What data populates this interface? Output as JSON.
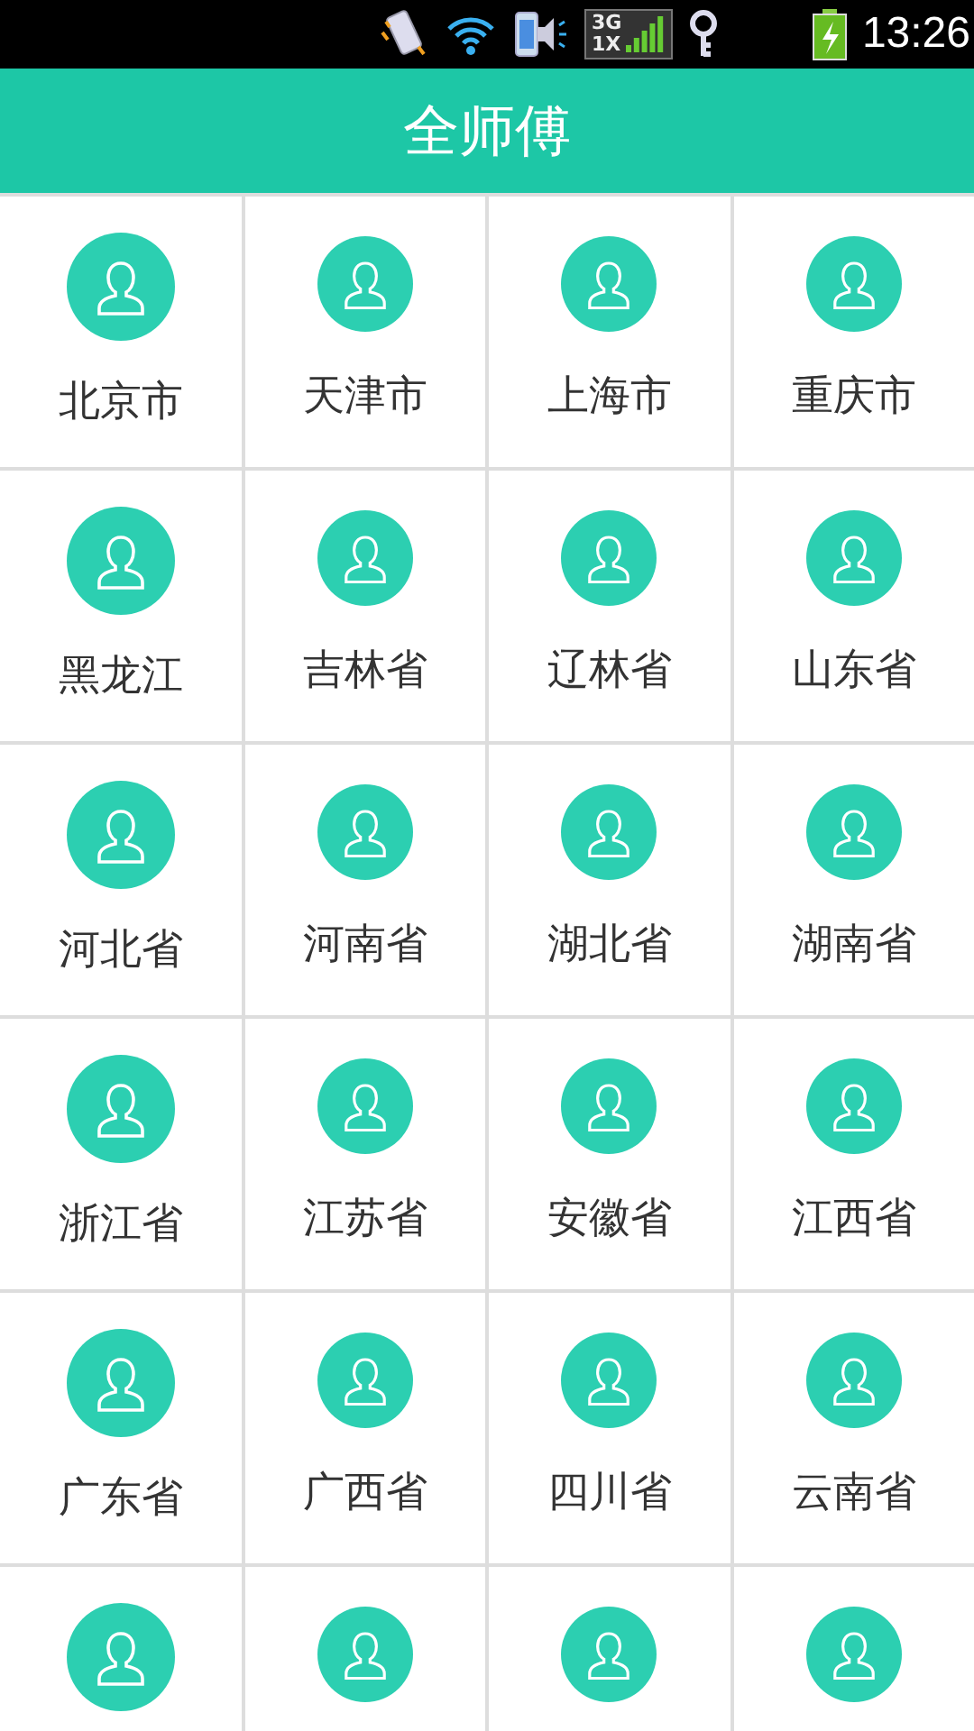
{
  "status_bar": {
    "network": [
      "3G",
      "1X"
    ],
    "time": "13:26"
  },
  "header": {
    "title": "全师傅"
  },
  "grid": [
    {
      "label": "北京市"
    },
    {
      "label": "天津市"
    },
    {
      "label": "上海市"
    },
    {
      "label": "重庆市"
    },
    {
      "label": "黑龙江"
    },
    {
      "label": "吉林省"
    },
    {
      "label": "辽林省"
    },
    {
      "label": "山东省"
    },
    {
      "label": "河北省"
    },
    {
      "label": "河南省"
    },
    {
      "label": "湖北省"
    },
    {
      "label": "湖南省"
    },
    {
      "label": "浙江省"
    },
    {
      "label": "江苏省"
    },
    {
      "label": "安徽省"
    },
    {
      "label": "江西省"
    },
    {
      "label": "广东省"
    },
    {
      "label": "广西省"
    },
    {
      "label": "四川省"
    },
    {
      "label": "云南省"
    },
    {
      "kind": "icon_only"
    },
    {
      "kind": "icon_only"
    },
    {
      "kind": "icon_only"
    },
    {
      "kind": "icon_only"
    }
  ]
}
